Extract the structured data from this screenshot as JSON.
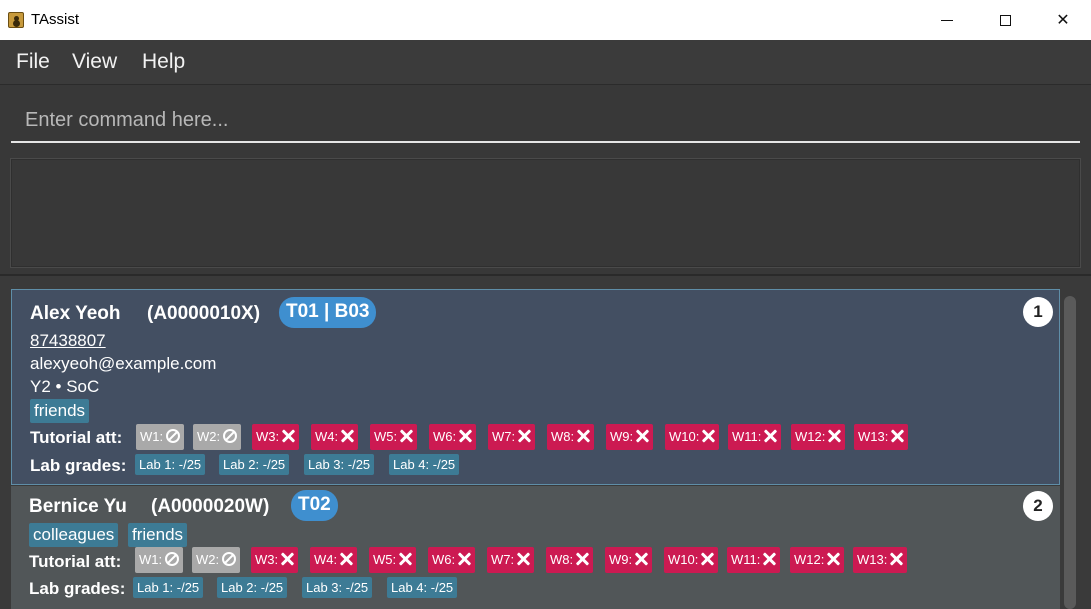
{
  "window": {
    "title": "TAssist",
    "minimize_symbol": "",
    "close_symbol": "✕"
  },
  "menu": [
    "File",
    "View",
    "Help"
  ],
  "command": {
    "placeholder": "Enter command here...",
    "value": ""
  },
  "result_display": "",
  "persons": [
    {
      "index": "1",
      "name": "Alex Yeoh",
      "student_id": "(A0000010X)",
      "group": "T01 | B03",
      "phone": "87438807",
      "email": "alexyeoh@example.com",
      "year_faculty": "Y2  •  SoC",
      "tags": [
        "friends"
      ],
      "tutorial_label": "Tutorial att:",
      "attendance": [
        {
          "week": "W1:",
          "status": "not-applicable"
        },
        {
          "week": "W2:",
          "status": "not-applicable"
        },
        {
          "week": "W3:",
          "status": "absent"
        },
        {
          "week": "W4:",
          "status": "absent"
        },
        {
          "week": "W5:",
          "status": "absent"
        },
        {
          "week": "W6:",
          "status": "absent"
        },
        {
          "week": "W7:",
          "status": "absent"
        },
        {
          "week": "W8:",
          "status": "absent"
        },
        {
          "week": "W9:",
          "status": "absent"
        },
        {
          "week": "W10:",
          "status": "absent"
        },
        {
          "week": "W11:",
          "status": "absent"
        },
        {
          "week": "W12:",
          "status": "absent"
        },
        {
          "week": "W13:",
          "status": "absent"
        }
      ],
      "lab_label": "Lab grades:",
      "labs": [
        "Lab 1: -/25",
        "Lab 2: -/25",
        "Lab 3: -/25",
        "Lab 4: -/25"
      ]
    },
    {
      "index": "2",
      "name": "Bernice Yu",
      "student_id": "(A0000020W)",
      "group": "T02",
      "tags": [
        "colleagues",
        "friends"
      ],
      "tutorial_label": "Tutorial att:",
      "attendance": [
        {
          "week": "W1:",
          "status": "not-applicable"
        },
        {
          "week": "W2:",
          "status": "not-applicable"
        },
        {
          "week": "W3:",
          "status": "absent"
        },
        {
          "week": "W4:",
          "status": "absent"
        },
        {
          "week": "W5:",
          "status": "absent"
        },
        {
          "week": "W6:",
          "status": "absent"
        },
        {
          "week": "W7:",
          "status": "absent"
        },
        {
          "week": "W8:",
          "status": "absent"
        },
        {
          "week": "W9:",
          "status": "absent"
        },
        {
          "week": "W10:",
          "status": "absent"
        },
        {
          "week": "W11:",
          "status": "absent"
        },
        {
          "week": "W12:",
          "status": "absent"
        },
        {
          "week": "W13:",
          "status": "absent"
        }
      ],
      "lab_label": "Lab grades:",
      "labs": [
        "Lab 1: -/25",
        "Lab 2: -/25",
        "Lab 3: -/25",
        "Lab 4: -/25"
      ]
    }
  ],
  "colors": {
    "absent": "#cc1a52",
    "not_applicable": "#a9a9a9",
    "tag": "#3d7b95",
    "group_badge": "#3f8fcf",
    "selected_card": "#434f62"
  }
}
